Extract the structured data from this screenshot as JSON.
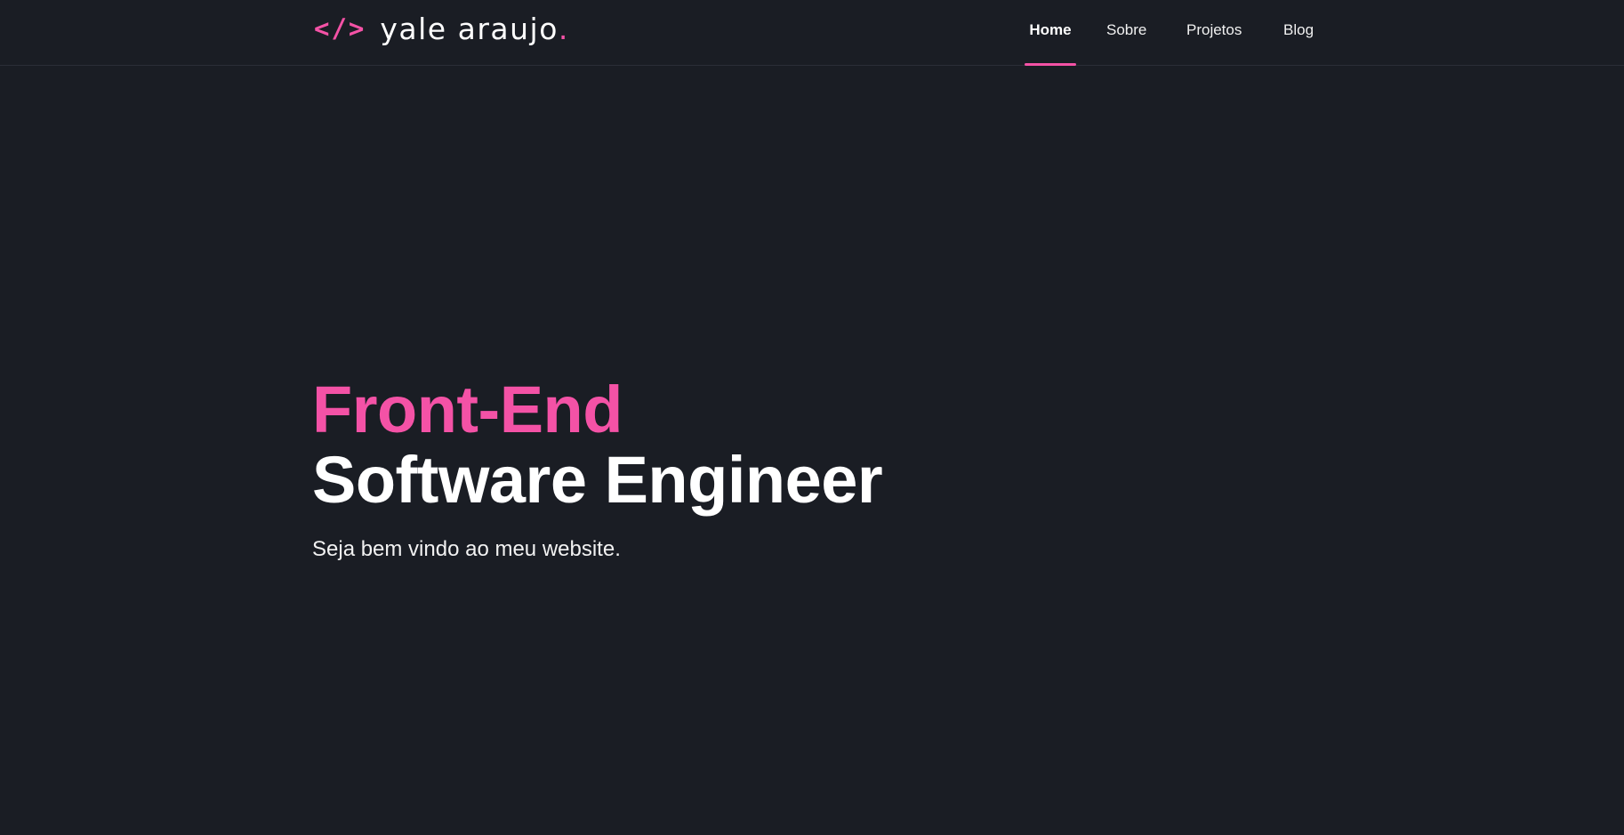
{
  "header": {
    "logo_icon": "</>",
    "logo_name": "yale araujo",
    "logo_dot": ".",
    "nav": [
      {
        "label": "Home",
        "active": true
      },
      {
        "label": "Sobre",
        "active": false
      },
      {
        "label": "Projetos",
        "active": false
      },
      {
        "label": "Blog",
        "active": false
      }
    ]
  },
  "hero": {
    "accent": "Front-End",
    "title": "Software Engineer",
    "subtitle": "Seja bem vindo ao meu website."
  },
  "colors": {
    "background": "#1a1d24",
    "accent": "#f452a6",
    "text": "#ffffff"
  }
}
